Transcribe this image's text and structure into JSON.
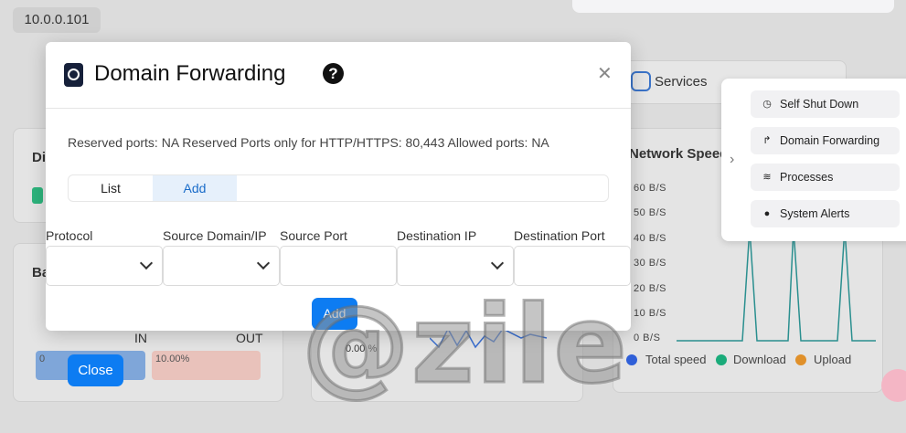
{
  "background": {
    "ip_address": "10.0.0.101",
    "services_label": "Services",
    "network_speed_title": "Network Speed",
    "y_axis_ticks": [
      "60 B/S",
      "50 B/S",
      "40 B/S",
      "30 B/S",
      "20 B/S",
      "10 B/S",
      "0 B/S"
    ],
    "legend": [
      {
        "label": "Total speed",
        "color": "#2f5fd8"
      },
      {
        "label": "Download",
        "color": "#1aab7a"
      },
      {
        "label": "Upload",
        "color": "#e0902a"
      }
    ],
    "left_card_title_1": "Di",
    "left_card_title_2": "Ba",
    "in_label": "IN",
    "out_label": "OUT",
    "in_value": "0",
    "out_value": "10.00%",
    "cpu_value": "0.00 %",
    "close_button": "Close"
  },
  "side_menu": {
    "items": [
      {
        "label": "Self Shut Down",
        "icon": "clock-icon"
      },
      {
        "label": "Domain Forwarding",
        "icon": "share-arrow-icon"
      },
      {
        "label": "Processes",
        "icon": "layers-icon"
      },
      {
        "label": "System Alerts",
        "icon": "alert-circle-icon"
      }
    ]
  },
  "modal": {
    "title": "Domain Forwarding",
    "info": "Reserved ports: NA  Reserved Ports only for HTTP/HTTPS: 80,443  Allowed ports: NA",
    "tabs": [
      "List",
      "Add"
    ],
    "active_tab": "Add",
    "fields": {
      "protocol": {
        "label": "Protocol",
        "value": ""
      },
      "source_domain": {
        "label": "Source Domain/IP",
        "value": ""
      },
      "source_port": {
        "label": "Source Port",
        "value": ""
      },
      "destination_ip": {
        "label": "Destination IP",
        "value": ""
      },
      "destination_port": {
        "label": "Destination Port",
        "value": ""
      }
    },
    "add_button": "Add"
  },
  "watermark": "@zile"
}
